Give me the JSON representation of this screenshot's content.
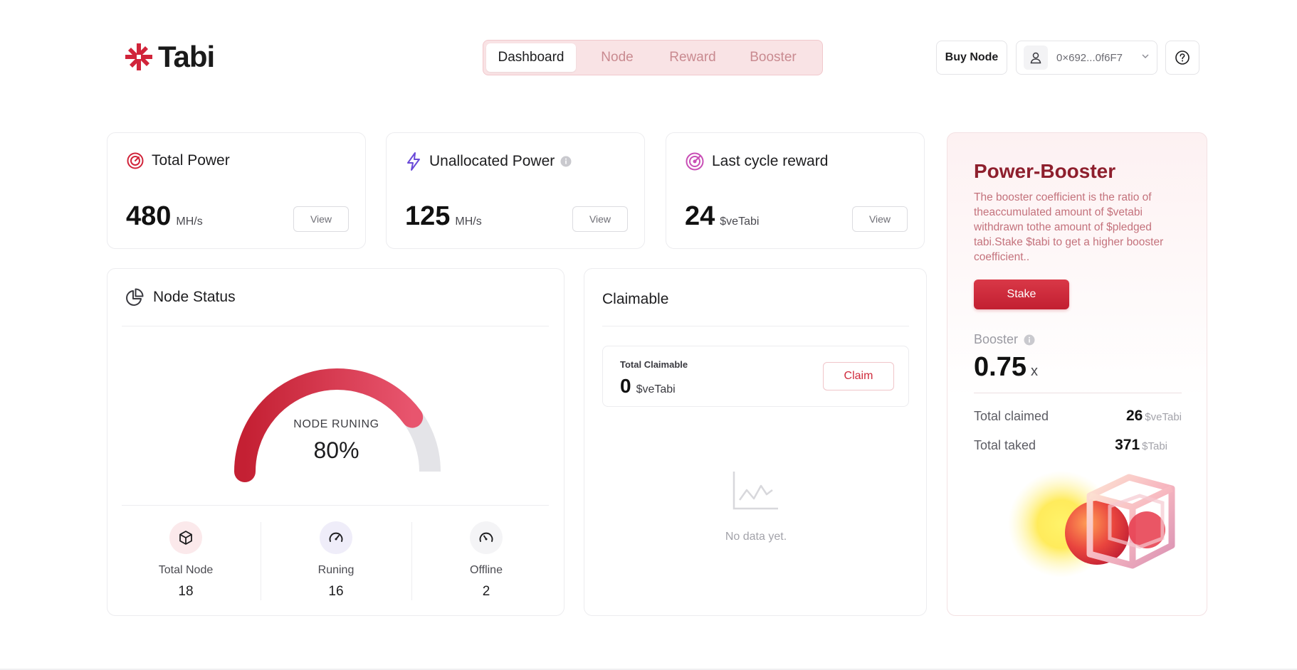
{
  "header": {
    "logo_text": "Tabi",
    "nav": [
      {
        "label": "Dashboard",
        "active": true
      },
      {
        "label": "Node",
        "active": false
      },
      {
        "label": "Reward",
        "active": false
      },
      {
        "label": "Booster",
        "active": false
      }
    ],
    "buy_node_label": "Buy Node",
    "wallet_address": "0×692...0f6F7",
    "wallet_icon": "user-icon",
    "help_icon": "help-circle-icon"
  },
  "stats": [
    {
      "title": "Total Power",
      "value": "480",
      "unit": "MH/s",
      "button": "View",
      "icon": "speedometer-icon",
      "info": false
    },
    {
      "title": "Unallocated Power",
      "value": "125",
      "unit": "MH/s",
      "button": "View",
      "icon": "lightning-icon",
      "info": true
    },
    {
      "title": "Last cycle reward",
      "value": "24",
      "unit": "$veTabi",
      "button": "View",
      "icon": "target-icon",
      "info": false
    }
  ],
  "node_status": {
    "title": "Node Status",
    "gauge_label": "NODE RUNING",
    "gauge_percent_text": "80%",
    "gauge_fraction": 0.8,
    "items": [
      {
        "label": "Total Node",
        "value": "18",
        "icon": "cube-icon"
      },
      {
        "label": "Runing",
        "value": "16",
        "icon": "gauge-high-icon"
      },
      {
        "label": "Offline",
        "value": "2",
        "icon": "gauge-low-icon"
      }
    ]
  },
  "claimable": {
    "title": "Claimable",
    "total_label": "Total Claimable",
    "total_value": "0",
    "total_unit": "$veTabi",
    "claim_button": "Claim",
    "empty_text": "No data yet."
  },
  "booster": {
    "title": "Power-Booster",
    "description": "The booster coefficient is the ratio of theaccumulated amount of $vetabi withdrawn tothe amount of $pledged tabi.Stake $tabi to get a higher booster coefficient..",
    "stake_button": "Stake",
    "booster_label": "Booster",
    "booster_value": "0.75",
    "booster_suffix": "x",
    "rows": [
      {
        "label": "Total claimed",
        "value": "26",
        "unit": "$veTabi"
      },
      {
        "label": "Total taked",
        "value": "371",
        "unit": "$Tabi"
      }
    ]
  },
  "colors": {
    "brand": "#d1243a",
    "brand_dark": "#8e1f2d",
    "nav_bg": "#f9e3e5",
    "lightning": "#6a4ad8",
    "target": "#c94fb6"
  }
}
